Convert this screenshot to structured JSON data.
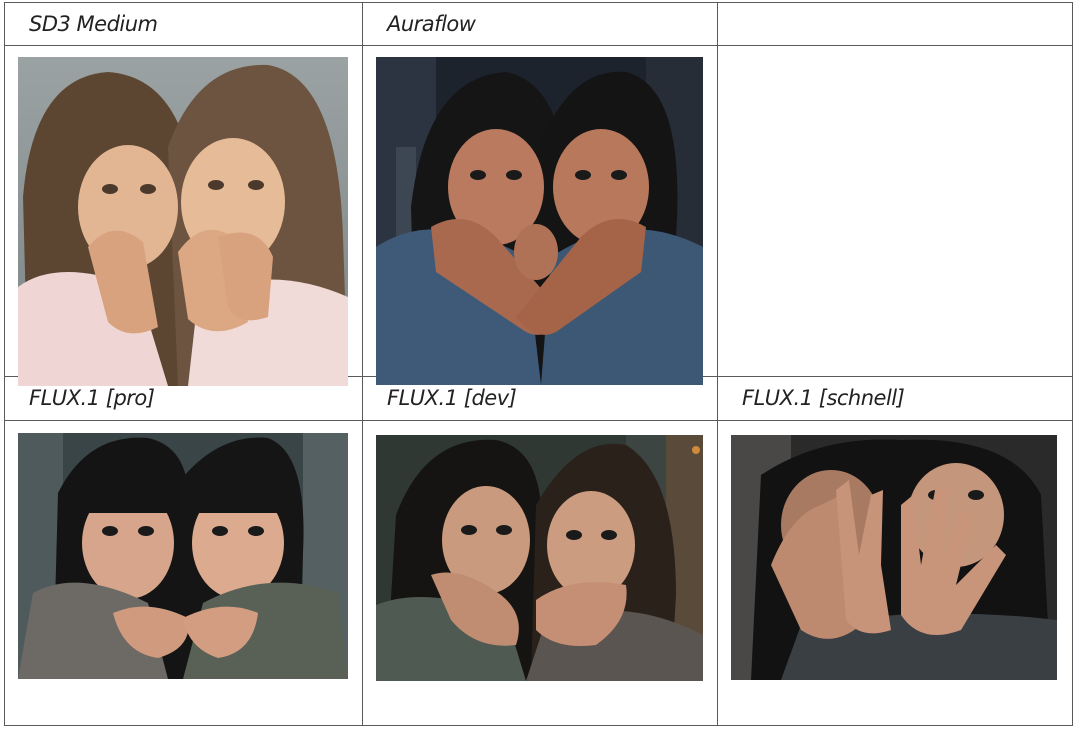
{
  "grid": {
    "rows": [
      {
        "headers": [
          "SD3 Medium",
          "Auraflow",
          ""
        ]
      },
      {
        "headers": [
          "FLUX.1 [pro]",
          "FLUX.1 [dev]",
          "FLUX.1 [schnell]"
        ]
      }
    ]
  },
  "images": {
    "sd3": {
      "subject": "two-girls-hands-framing-faces",
      "palette": "soft-grey-pink"
    },
    "auraflow": {
      "subject": "two-girls-crying-crossed-arms",
      "palette": "dark-blue-street"
    },
    "flux_pro": {
      "subject": "two-girls-cupped-hands",
      "palette": "dark-teal-street"
    },
    "flux_dev": {
      "subject": "two-girls-chin-on-hands",
      "palette": "dark-green-street"
    },
    "flux_schnell": {
      "subject": "girls-covering-face-hands",
      "palette": "dark-grey"
    }
  }
}
